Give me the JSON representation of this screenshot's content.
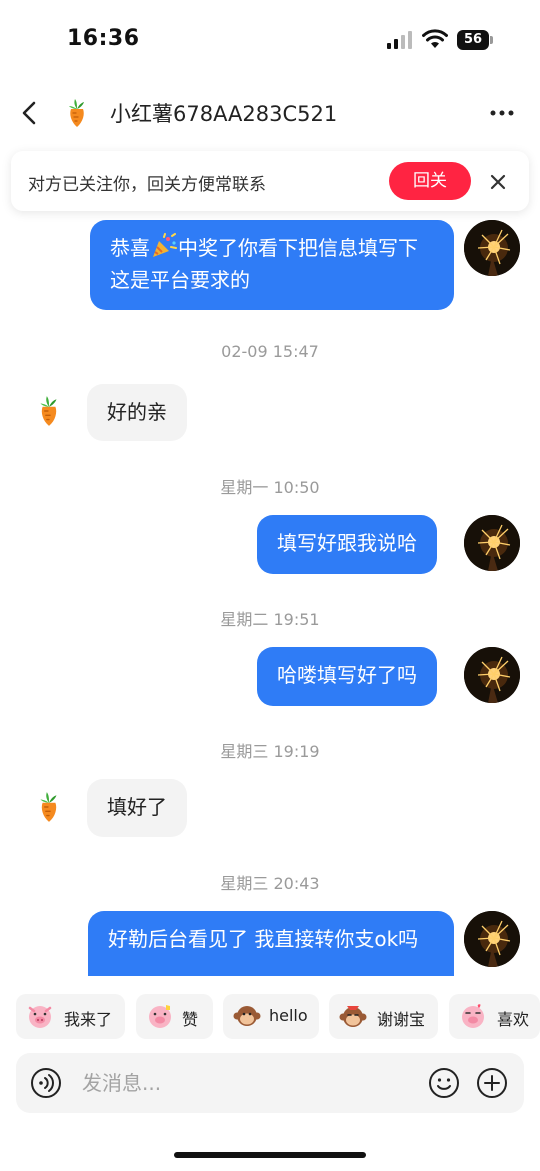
{
  "status_bar": {
    "time": "16:36",
    "battery": "56"
  },
  "header": {
    "title": "小红薯678AA283C521",
    "avatar_icon": "carrot-icon",
    "back_icon": "chevron-left-icon",
    "more_icon": "more-dots-icon"
  },
  "follow_banner": {
    "text": "对方已关注你，回关方便常联系",
    "button_label": "回关",
    "close_icon": "close-icon"
  },
  "messages": [
    {
      "sender": "self",
      "text_a": "恭喜",
      "emoji": "party-popper-icon",
      "text_b": "中奖了你看下把信息填写下这是平台要求的"
    },
    {
      "type": "time",
      "text": "02-09 15:47"
    },
    {
      "sender": "other",
      "text": "好的亲"
    },
    {
      "type": "time",
      "text": "星期一 10:50"
    },
    {
      "sender": "self",
      "text": "填写好跟我说哈"
    },
    {
      "type": "time",
      "text": "星期二 19:51"
    },
    {
      "sender": "self",
      "text": "哈喽填写好了吗"
    },
    {
      "type": "time",
      "text": "星期三 19:19"
    },
    {
      "sender": "other",
      "text": "填好了"
    },
    {
      "type": "time",
      "text": "星期三 20:43"
    },
    {
      "sender": "self",
      "text": "好勒后台看见了 我直接转你支ok吗"
    }
  ],
  "quick_replies": [
    {
      "label": "我来了",
      "icon": "pig-wave-emoji"
    },
    {
      "label": "赞",
      "icon": "pig-thumbs-up-emoji"
    },
    {
      "label": "hello",
      "icon": "monkey-hello-emoji"
    },
    {
      "label": "谢谢宝",
      "icon": "monkey-thanks-emoji"
    },
    {
      "label": "喜欢",
      "icon": "pig-love-emoji"
    }
  ],
  "input": {
    "placeholder": "发消息...",
    "value": ""
  },
  "colors": {
    "accent_red": "#ff2442",
    "bubble_blue": "#2f7cf6",
    "bubble_gray": "#f3f3f3"
  }
}
